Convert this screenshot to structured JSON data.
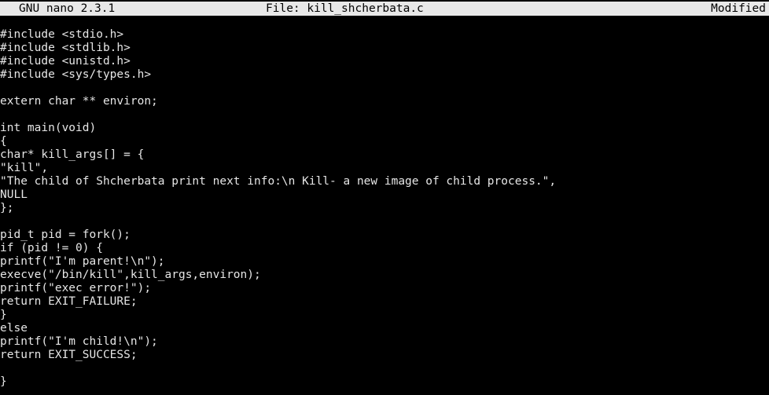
{
  "titlebar": {
    "app_version": "GNU nano 2.3.1",
    "file_label": "File: kill_shcherbata.c",
    "status": "Modified"
  },
  "editor": {
    "lines": [
      "#include <stdio.h>",
      "#include <stdlib.h>",
      "#include <unistd.h>",
      "#include <sys/types.h>",
      "",
      "extern char ** environ;",
      "",
      "int main(void)",
      "{",
      "char* kill_args[] = {",
      "\"kill\",",
      "\"The child of Shcherbata print next info:\\n Kill- a new image of child process.\",",
      "NULL",
      "};",
      "",
      "pid_t pid = fork();",
      "if (pid != 0) {",
      "printf(\"I'm parent!\\n\");",
      "execve(\"/bin/kill\",kill_args,environ);",
      "printf(\"exec error!\");",
      "return EXIT_FAILURE;",
      "}",
      "else",
      "printf(\"I'm child!\\n\");",
      "return EXIT_SUCCESS;",
      "",
      "}"
    ]
  }
}
